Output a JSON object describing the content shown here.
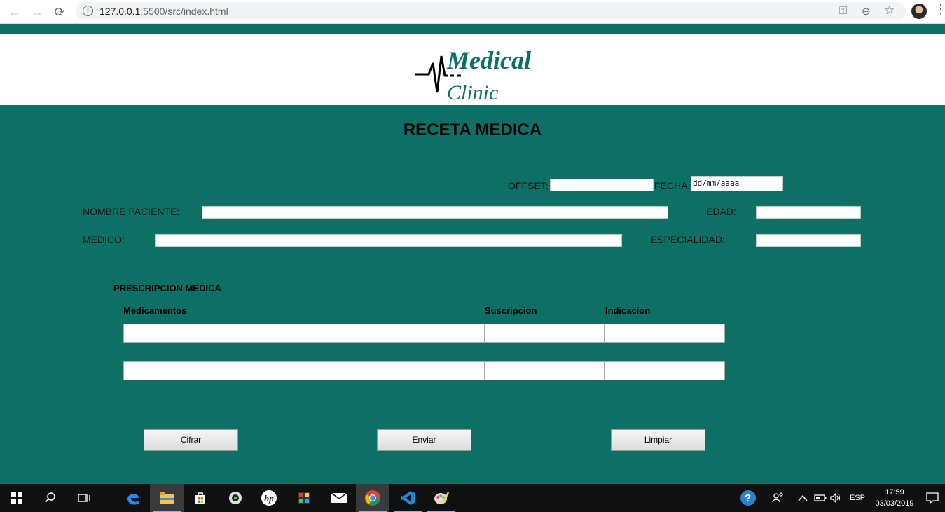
{
  "browser": {
    "url_host": "127.0.0.1",
    "url_rest": ":5500/src/index.html",
    "back_icon": "←",
    "forward_icon": "→",
    "reload_icon": "⟳",
    "info_icon": "i",
    "key_icon": "⚿",
    "zoom_icon": "⊖",
    "star_icon": "☆",
    "menu_icon": "⋮"
  },
  "logo": {
    "line1": "Medical",
    "line2": "Clinic"
  },
  "page": {
    "title": "RECETA MEDICA",
    "offset_label": "OFFSET:",
    "offset_value": "",
    "fecha_label": "FECHA:",
    "fecha_placeholder": "dd/mm/aaaa",
    "nombre_label": "NOMBRE PACIENTE:",
    "edad_label": "EDAD:",
    "medico_label": "MEDICO:",
    "especialidad_label": "ESPECIALIDAD:",
    "prescripcion_title": "PRESCRIPCION MEDICA",
    "columns": [
      "Medicamentos",
      "Suscripcion",
      "Indicacion"
    ],
    "buttons": {
      "cifrar": "Cifrar",
      "enviar": "Enviar",
      "limpiar": "Limpiar"
    }
  },
  "taskbar": {
    "language": "ESP",
    "time": "17:59",
    "date": "03/03/2019"
  },
  "colors": {
    "page_bg": "#0e6f65",
    "logo": "#0e6f65"
  }
}
